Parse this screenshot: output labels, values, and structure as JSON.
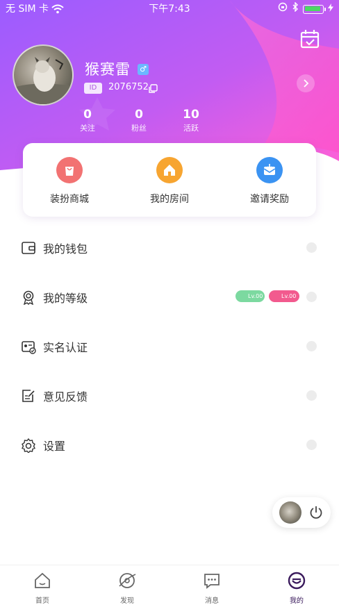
{
  "status_bar": {
    "carrier": "无 SIM 卡",
    "time": "下午7:43"
  },
  "profile": {
    "username": "猴赛雷",
    "gender_symbol": "♂",
    "id_label": "ID",
    "id_value": "2076752",
    "stats": [
      {
        "value": "0",
        "label": "关注"
      },
      {
        "value": "0",
        "label": "粉丝"
      },
      {
        "value": "10",
        "label": "活跃"
      }
    ]
  },
  "quick_actions": [
    {
      "label": "装扮商城",
      "icon": "shopping-bag-icon",
      "color": "#f26b6b"
    },
    {
      "label": "我的房间",
      "icon": "home-icon",
      "color": "#f7a531"
    },
    {
      "label": "邀请奖励",
      "icon": "envelope-icon",
      "color": "#3b93f2"
    }
  ],
  "menu": [
    {
      "label": "我的钱包",
      "icon": "wallet-icon"
    },
    {
      "label": "我的等级",
      "icon": "medal-icon"
    },
    {
      "label": "实名认证",
      "icon": "id-card-icon"
    },
    {
      "label": "意见反馈",
      "icon": "feedback-icon"
    },
    {
      "label": "设置",
      "icon": "settings-icon"
    }
  ],
  "levels": [
    {
      "text": "Lv.00",
      "color": "#7cd9a0"
    },
    {
      "text": "Lv.00",
      "color": "#f25a8e"
    }
  ],
  "tabs": [
    {
      "label": "首页",
      "icon": "home-tab-icon"
    },
    {
      "label": "发现",
      "icon": "discover-icon"
    },
    {
      "label": "消息",
      "icon": "message-icon"
    },
    {
      "label": "我的",
      "icon": "profile-tab-icon"
    }
  ],
  "colors": {
    "hero_start": "#a45bff",
    "hero_end": "#ff5fd7",
    "active_tab": "#5a1e8c"
  }
}
